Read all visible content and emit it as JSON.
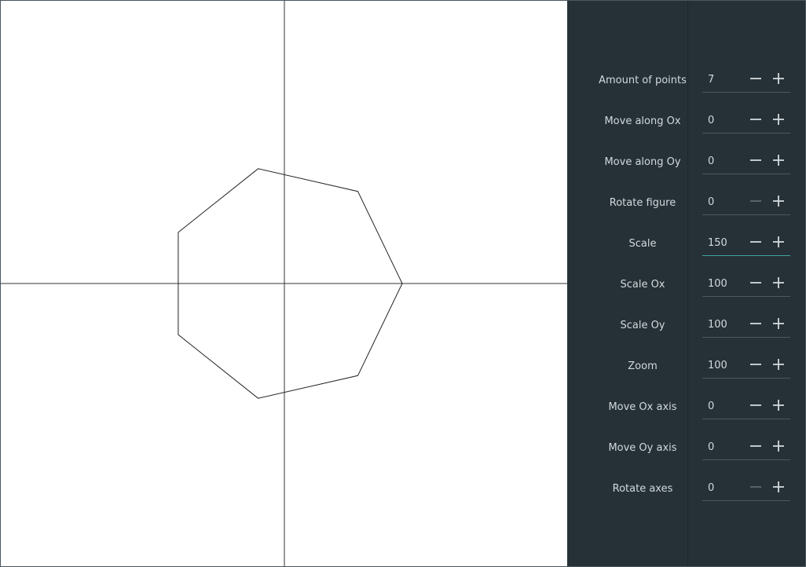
{
  "controls": [
    {
      "label": "Amount of points",
      "value": "7",
      "minus_enabled": true,
      "plus_enabled": true
    },
    {
      "label": "Move along Ox",
      "value": "0",
      "minus_enabled": true,
      "plus_enabled": true
    },
    {
      "label": "Move along Oy",
      "value": "0",
      "minus_enabled": true,
      "plus_enabled": true
    },
    {
      "label": "Rotate figure",
      "value": "0",
      "minus_enabled": false,
      "plus_enabled": true
    },
    {
      "label": "Scale",
      "value": "150",
      "minus_enabled": true,
      "plus_enabled": true,
      "focused": true
    },
    {
      "label": "Scale Ox",
      "value": "100",
      "minus_enabled": true,
      "plus_enabled": true
    },
    {
      "label": "Scale Oy",
      "value": "100",
      "minus_enabled": true,
      "plus_enabled": true
    },
    {
      "label": "Zoom",
      "value": "100",
      "minus_enabled": true,
      "plus_enabled": true
    },
    {
      "label": "Move Ox axis",
      "value": "0",
      "minus_enabled": true,
      "plus_enabled": true
    },
    {
      "label": "Move Oy axis",
      "value": "0",
      "minus_enabled": true,
      "plus_enabled": true
    },
    {
      "label": "Rotate axes",
      "value": "0",
      "minus_enabled": false,
      "plus_enabled": true
    }
  ],
  "figure": {
    "points": 7,
    "scale": 150,
    "offset_x": 0,
    "offset_y": 0,
    "rotation": 0,
    "scale_ox": 100,
    "scale_oy": 100,
    "zoom": 100
  },
  "colors": {
    "panel": "#263137",
    "canvas": "#ffffff",
    "text": "#d2d9dd",
    "accent": "#3fa39a",
    "disabled": "#5d686f"
  },
  "icons": {
    "minus": "minus-icon",
    "plus": "plus-icon"
  }
}
